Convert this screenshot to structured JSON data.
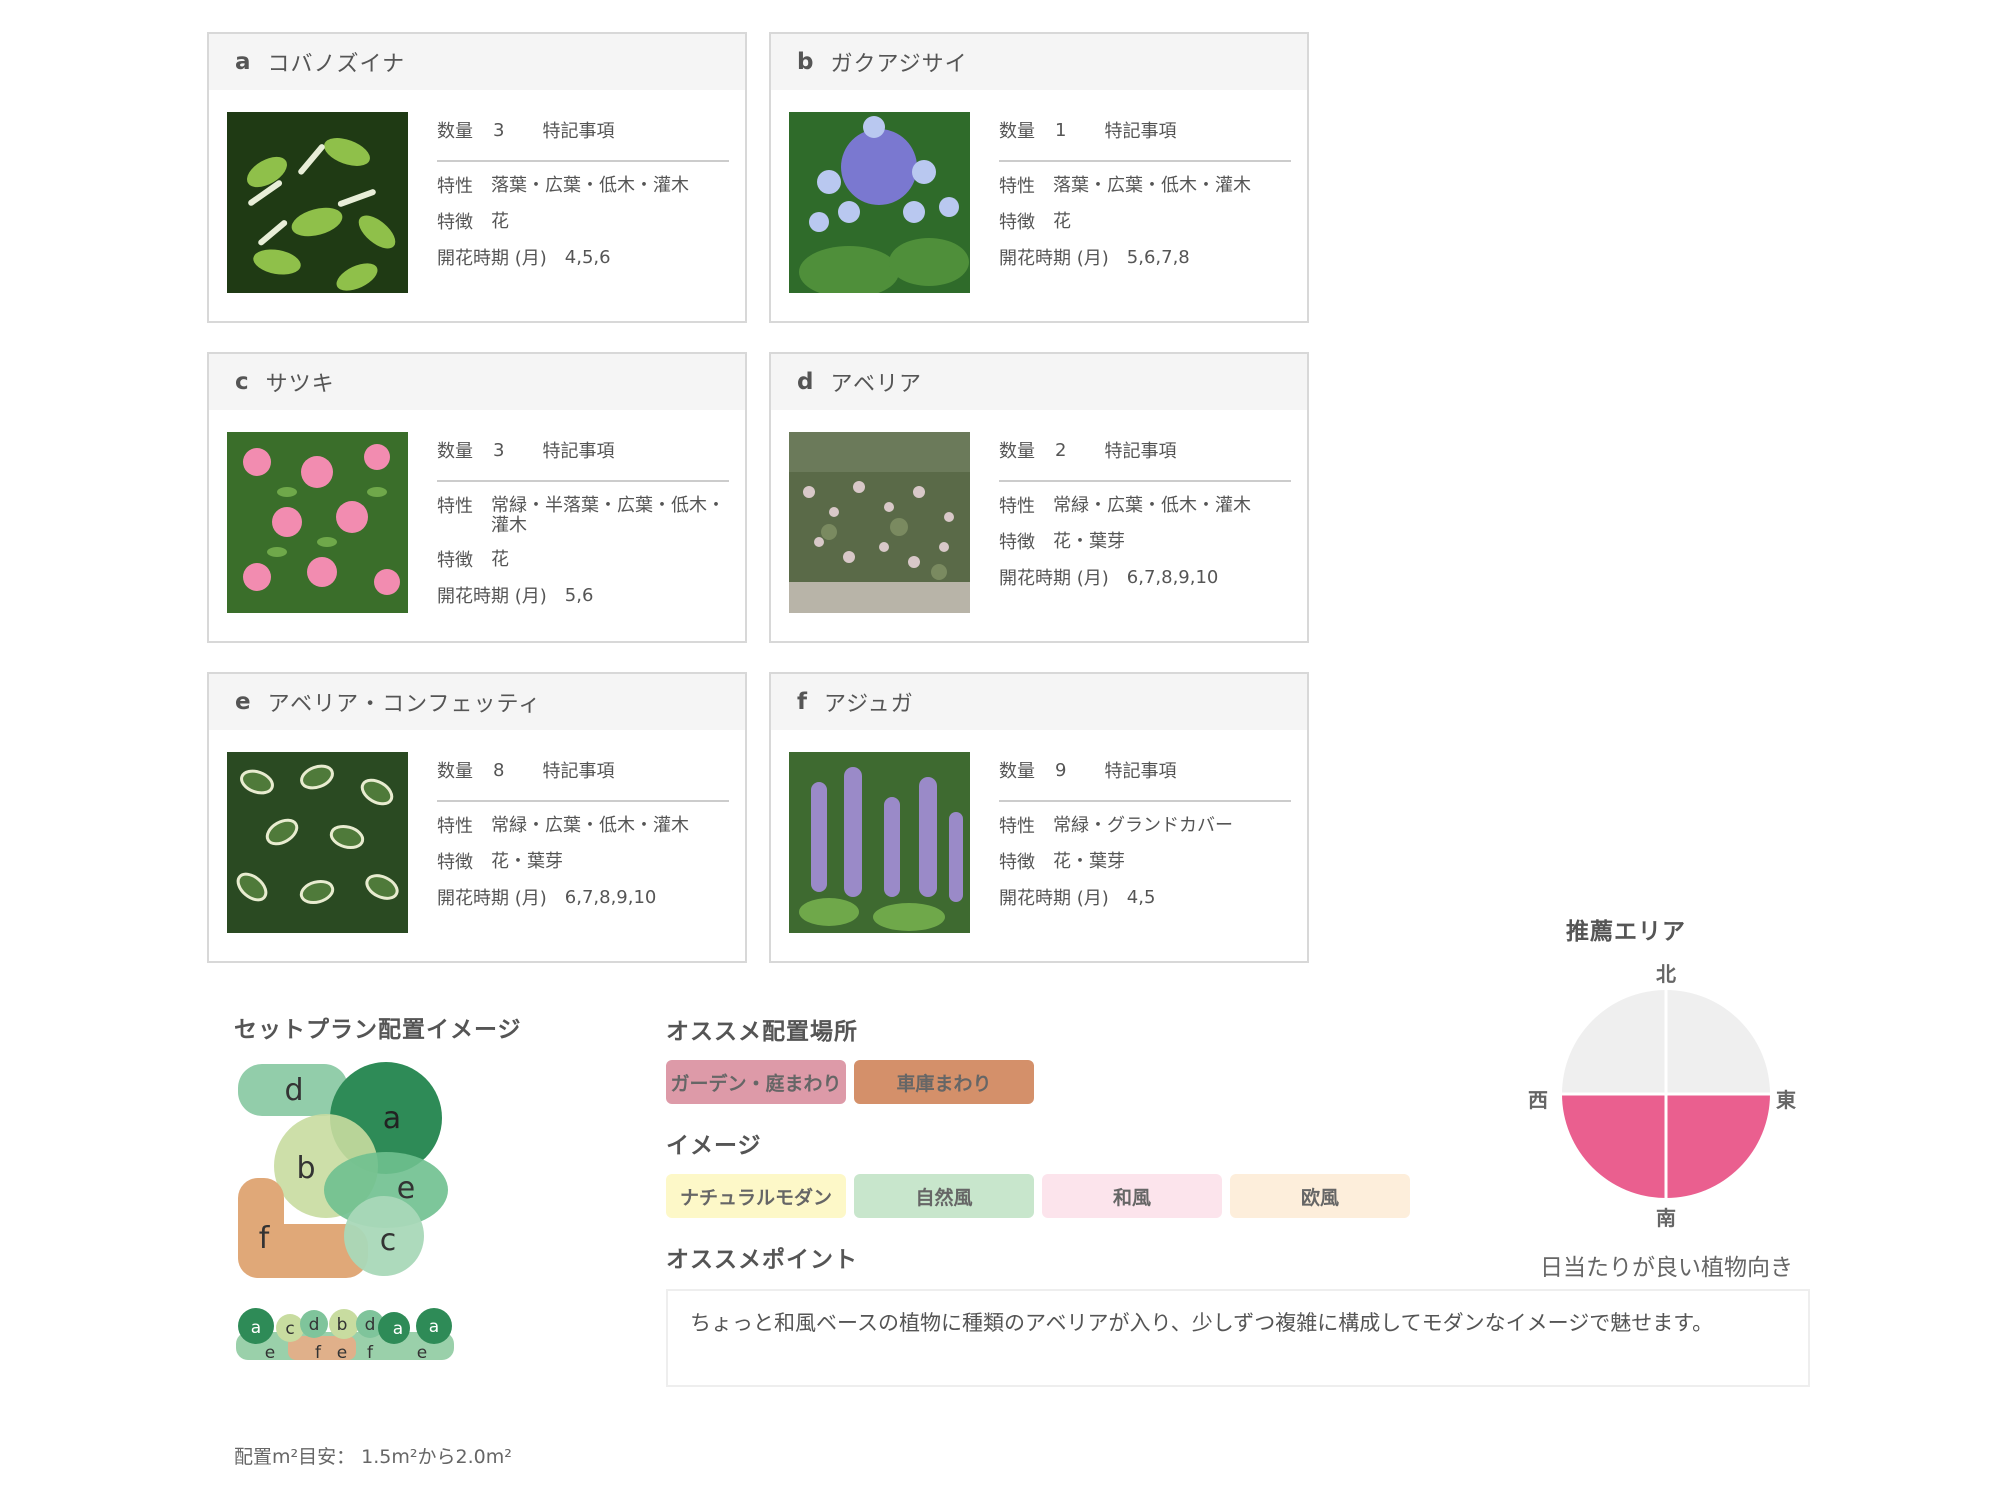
{
  "cards": [
    {
      "letter": "a",
      "name": "コバノズイナ",
      "qty_label": "数量",
      "qty": "3",
      "note_label": "特記事項",
      "trait_label": "特性",
      "trait": "落葉・広葉・低木・灌木",
      "feature_label": "特徴",
      "feature": "花",
      "bloom_label": "開花時期 (月)",
      "bloom": "4,5,6",
      "photo_icon": "sweetspire-photo"
    },
    {
      "letter": "b",
      "name": "ガクアジサイ",
      "qty_label": "数量",
      "qty": "1",
      "note_label": "特記事項",
      "trait_label": "特性",
      "trait": "落葉・広葉・低木・灌木",
      "feature_label": "特徴",
      "feature": "花",
      "bloom_label": "開花時期 (月)",
      "bloom": "5,6,7,8",
      "photo_icon": "lacecap-hydrangea-photo"
    },
    {
      "letter": "c",
      "name": "サツキ",
      "qty_label": "数量",
      "qty": "3",
      "note_label": "特記事項",
      "trait_label": "特性",
      "trait": "常緑・半落葉・広葉・低木・灌木",
      "feature_label": "特徴",
      "feature": "花",
      "bloom_label": "開花時期 (月)",
      "bloom": "5,6",
      "photo_icon": "satsuki-azalea-photo"
    },
    {
      "letter": "d",
      "name": "アベリア",
      "qty_label": "数量",
      "qty": "2",
      "note_label": "特記事項",
      "trait_label": "特性",
      "trait": "常緑・広葉・低木・灌木",
      "feature_label": "特徴",
      "feature": "花・葉芽",
      "bloom_label": "開花時期 (月)",
      "bloom": "6,7,8,9,10",
      "photo_icon": "abelia-photo"
    },
    {
      "letter": "e",
      "name": "アベリア・コンフェッティ",
      "qty_label": "数量",
      "qty": "8",
      "note_label": "特記事項",
      "trait_label": "特性",
      "trait": "常緑・広葉・低木・灌木",
      "feature_label": "特徴",
      "feature": "花・葉芽",
      "bloom_label": "開花時期 (月)",
      "bloom": "6,7,8,9,10",
      "photo_icon": "abelia-confetti-photo"
    },
    {
      "letter": "f",
      "name": "アジュガ",
      "qty_label": "数量",
      "qty": "9",
      "note_label": "特記事項",
      "trait_label": "特性",
      "trait": "常緑・グランドカバー",
      "feature_label": "特徴",
      "feature": "花・葉芽",
      "bloom_label": "開花時期 (月)",
      "bloom": "4,5",
      "photo_icon": "ajuga-photo"
    }
  ],
  "layout_section": {
    "title": "セットプラン配置イメージ",
    "area_text": "配置m²目安： 1.5m²から2.0m²",
    "top_view_labels": [
      "d",
      "a",
      "b",
      "e",
      "f",
      "c"
    ],
    "side_view_labels": [
      "a",
      "c",
      "d",
      "b",
      "d",
      "a",
      "a",
      "e",
      "f",
      "e",
      "f",
      "e"
    ]
  },
  "placement": {
    "title": "オススメ配置場所",
    "tags": [
      {
        "label": "ガーデン・庭まわり",
        "color": "#dd9aa8"
      },
      {
        "label": "車庫まわり",
        "color": "#d4906a"
      }
    ]
  },
  "image_style": {
    "title": "イメージ",
    "tags": [
      {
        "label": "ナチュラルモダン",
        "color": "#fdf8c8"
      },
      {
        "label": "自然風",
        "color": "#c8e6cc"
      },
      {
        "label": "和風",
        "color": "#fce4ec"
      },
      {
        "label": "欧風",
        "color": "#fdeedb"
      }
    ]
  },
  "point": {
    "title": "オススメポイント",
    "text": "ちょっと和風ベースの植物に種類のアベリアが入り、少しずつ複雑に構成してモダンなイメージで魅せます。"
  },
  "recommended_area": {
    "title": "推薦エリア",
    "north": "北",
    "south": "南",
    "east": "東",
    "west": "西",
    "caption": "日当たりが良い植物向き",
    "highlight_color": "#ea5f8f",
    "base_color": "#efefef"
  }
}
